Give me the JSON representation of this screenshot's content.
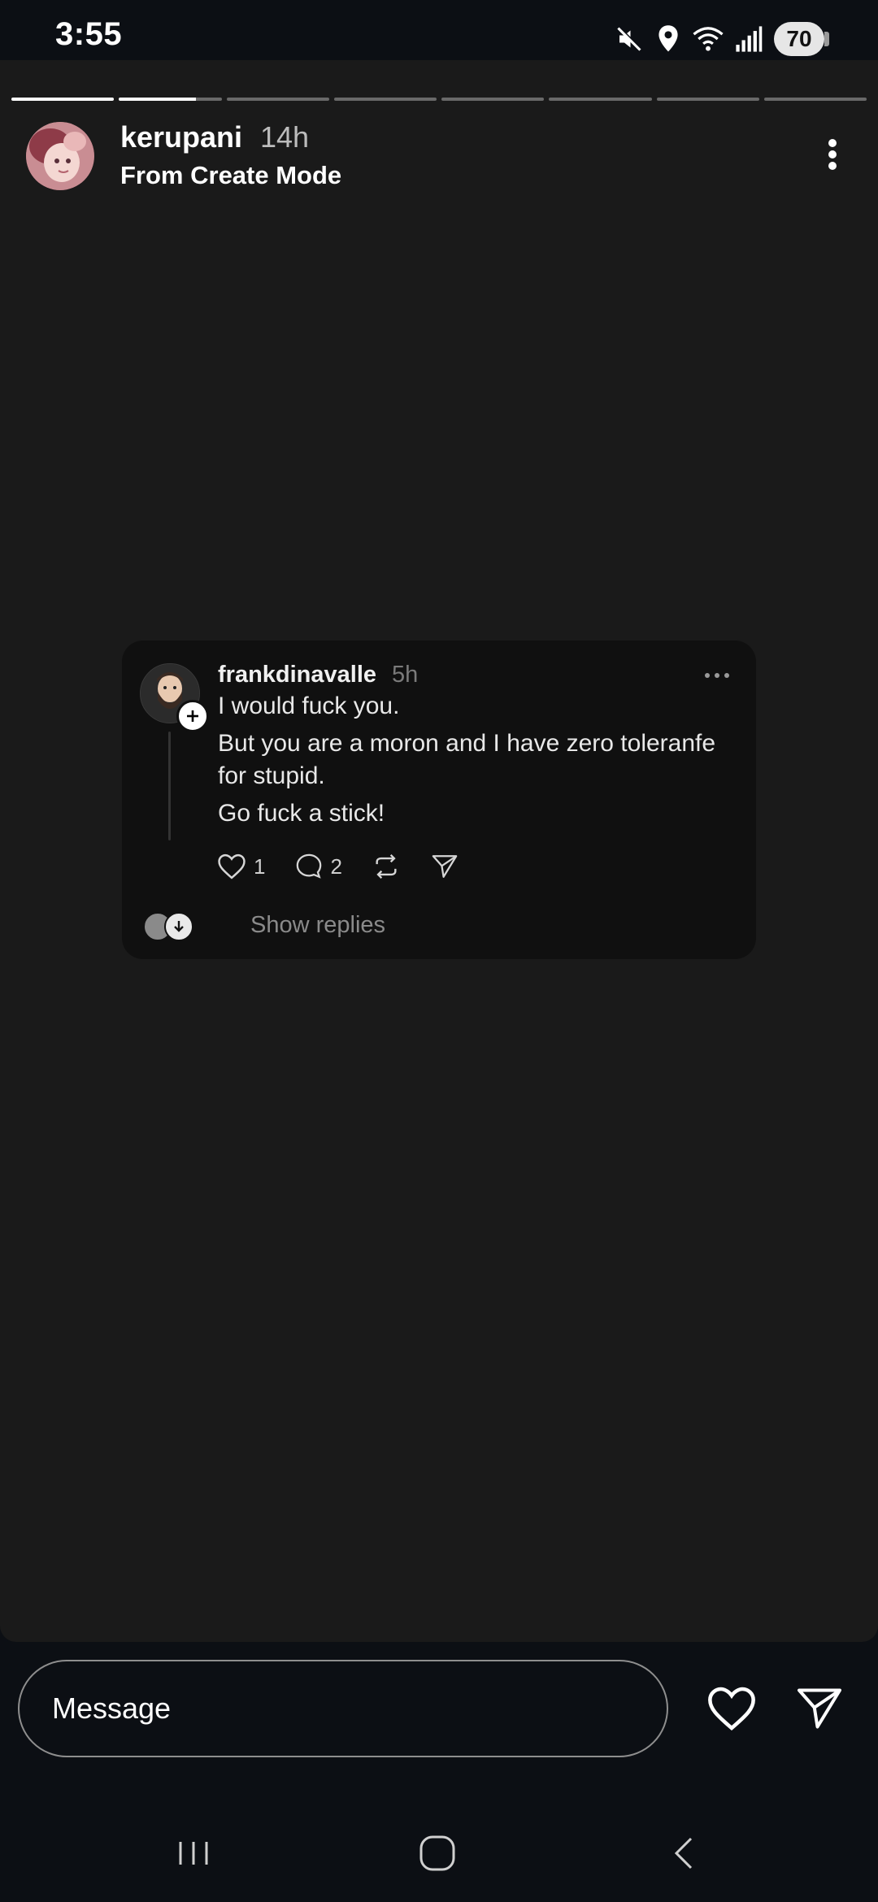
{
  "status_bar": {
    "time": "3:55",
    "battery": "70",
    "icons": [
      "mute-icon",
      "location-icon",
      "wifi-icon",
      "signal-icon",
      "battery-icon"
    ]
  },
  "story": {
    "segments": [
      {
        "progress": 1.0
      },
      {
        "progress": 0.75
      },
      {
        "progress": 0
      },
      {
        "progress": 0
      },
      {
        "progress": 0
      },
      {
        "progress": 0
      },
      {
        "progress": 0
      },
      {
        "progress": 0
      }
    ],
    "username": "kerupani",
    "time": "14h",
    "subtitle": "From Create Mode"
  },
  "thread": {
    "username": "frankdinavalle",
    "time": "5h",
    "lines": [
      "I would fuck you.",
      "But you are a moron and I have zero toleranfe",
      "for stupid.",
      "Go fuck a stick!"
    ],
    "likes": "1",
    "replies": "2",
    "show_replies": "Show replies"
  },
  "message": {
    "placeholder": "Message"
  },
  "colors": {
    "story_bg": "#1a1a1a",
    "card_bg": "#101010",
    "chrome_bg": "#0c0f14"
  }
}
